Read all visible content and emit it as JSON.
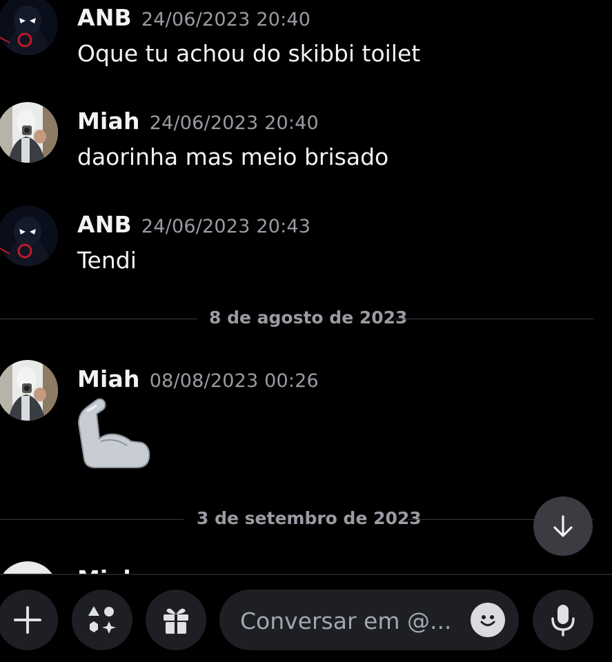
{
  "messages": [
    {
      "author": "ANB",
      "timestamp": "24/06/2023 20:40",
      "text": "Oque tu achou do skibbi toilet"
    },
    {
      "author": "Miah",
      "timestamp": "24/06/2023 20:40",
      "text": "daorinha mas meio brisado"
    },
    {
      "author": "ANB",
      "timestamp": "24/06/2023 20:43",
      "text": "Tendi"
    },
    {
      "author": "Miah",
      "timestamp": "08/08/2023 00:26",
      "emoji": "flexed-biceps"
    }
  ],
  "dividers": [
    "8 de agosto de 2023",
    "3 de setembro de 2023"
  ],
  "partial_message": {
    "author": "Miah"
  },
  "composer": {
    "placeholder": "Conversar em @..."
  },
  "colors": {
    "background": "#000000",
    "divider_text": "#9a9ca3",
    "button_bg": "#1e1f24",
    "jump_bg": "#3a3c42"
  }
}
